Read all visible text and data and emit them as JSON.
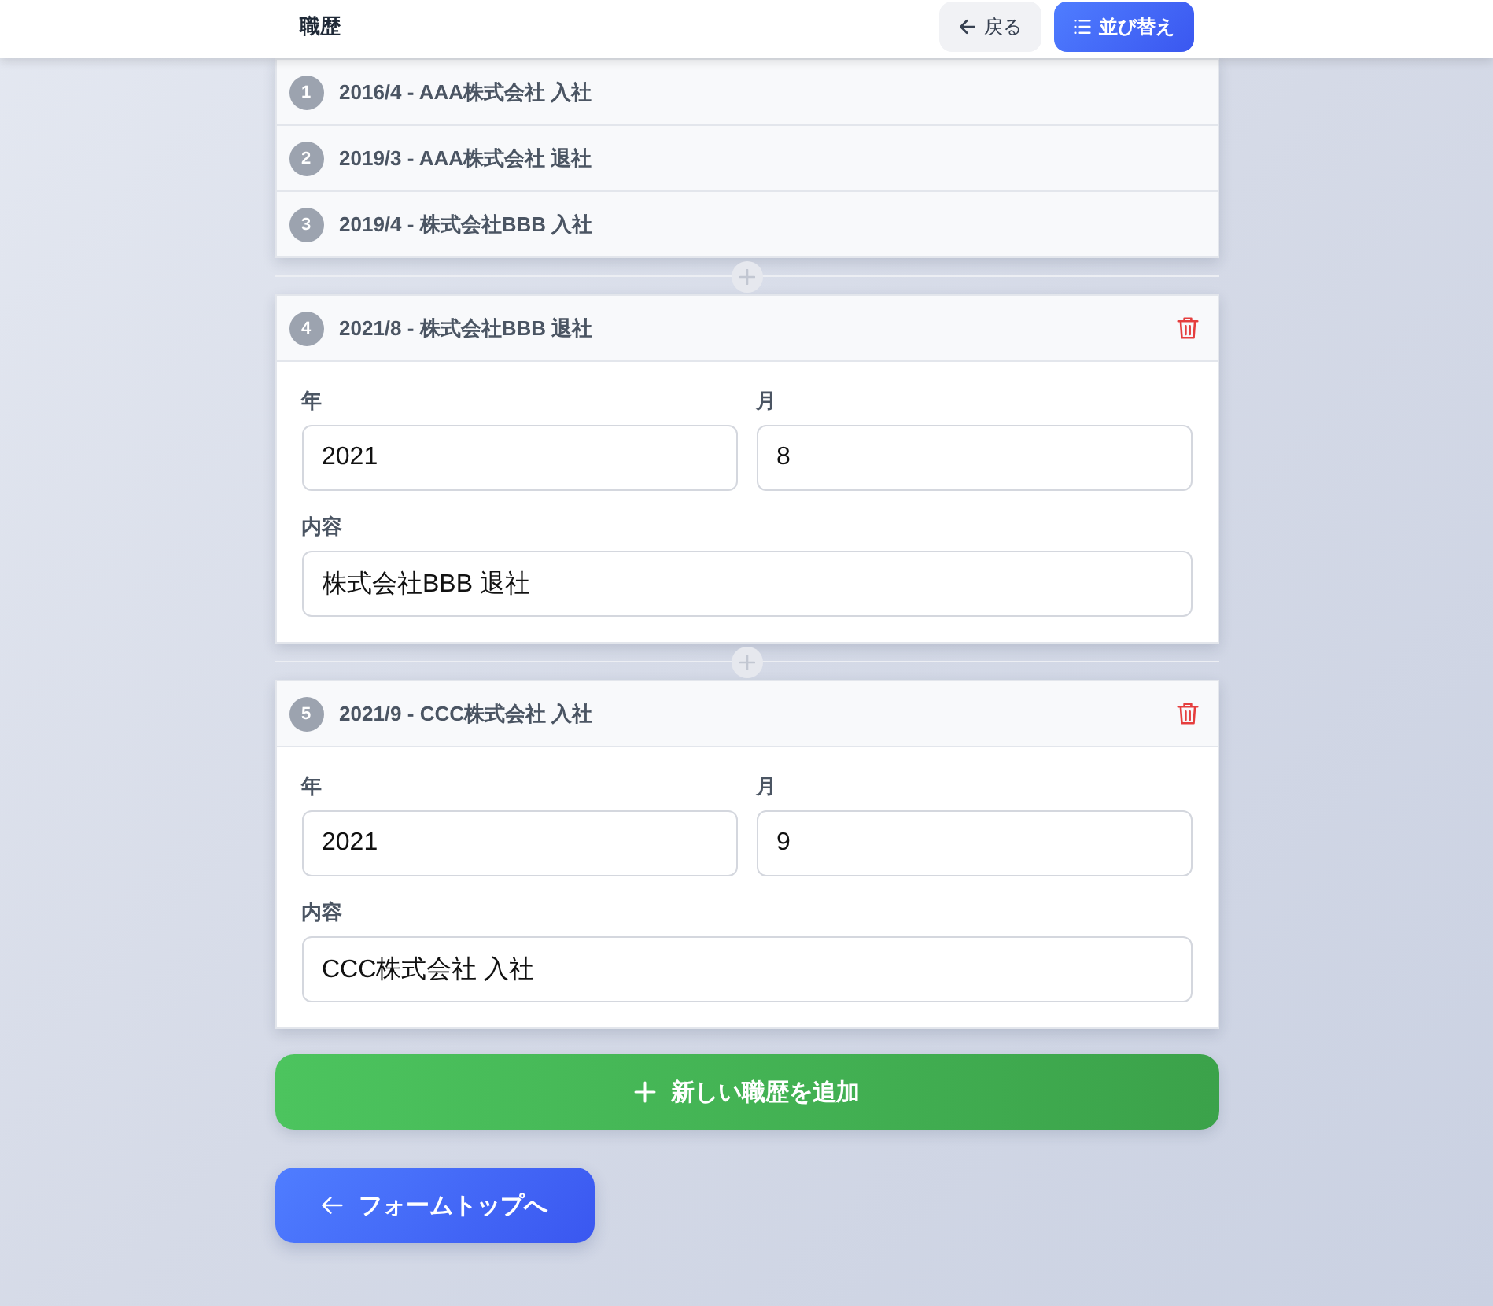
{
  "header": {
    "title": "職歴",
    "back_button": "戻る",
    "sort_button": "並び替え"
  },
  "entries": [
    {
      "number": "1",
      "title": "2016/4 - AAA株式会社 入社",
      "expanded": false
    },
    {
      "number": "2",
      "title": "2019/3 - AAA株式会社 退社",
      "expanded": false
    },
    {
      "number": "3",
      "title": "2019/4 - 株式会社BBB 入社",
      "expanded": false
    },
    {
      "number": "4",
      "title": "2021/8 - 株式会社BBB 退社",
      "expanded": true,
      "fields": [
        {
          "kind": "half",
          "label": "年",
          "value": "2021"
        },
        {
          "kind": "half",
          "label": "月",
          "value": "8"
        },
        {
          "kind": "full",
          "label": "内容",
          "value": "株式会社BBB 退社"
        }
      ]
    },
    {
      "number": "5",
      "title": "2021/9 - CCC株式会社 入社",
      "expanded": true,
      "fields": [
        {
          "kind": "half",
          "label": "年",
          "value": "2021"
        },
        {
          "kind": "half",
          "label": "月",
          "value": "9"
        },
        {
          "kind": "full",
          "label": "内容",
          "value": "CCC株式会社 入社"
        }
      ]
    }
  ],
  "add_button": "新しい職歴を追加",
  "footer_button": "フォームトップへ"
}
